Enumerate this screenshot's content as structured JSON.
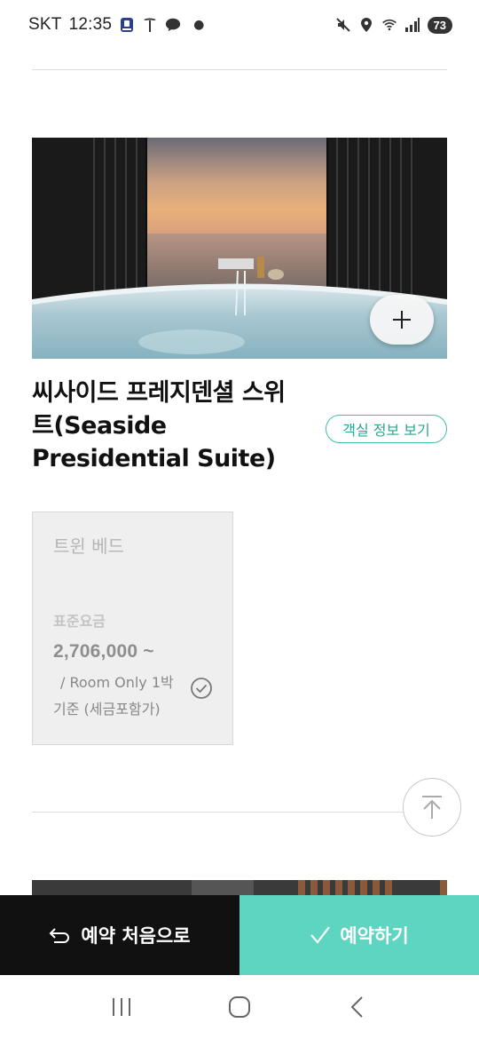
{
  "status_bar": {
    "carrier": "SKT",
    "time": "12:35",
    "battery": "73",
    "talk_badge": "TALK"
  },
  "room": {
    "title": "씨사이드 프레지덴셜 스위트(Seaside Presidential Suite)",
    "info_button": "객실 정보 보기",
    "image_icon": "plus-icon"
  },
  "bed_option": {
    "bed_type": "트윈 베드",
    "rate_label": "표준요금",
    "price": "2,706,000 ~",
    "note_line1": "/ Room Only 1박",
    "note_line2": "기준 (세금포함가)",
    "selected": true
  },
  "actions": {
    "back_label": "예약 처음으로",
    "reserve_label": "예약하기"
  },
  "colors": {
    "accent": "#5dd5c1",
    "accent_text": "#2aa58f",
    "dark": "#111111"
  }
}
